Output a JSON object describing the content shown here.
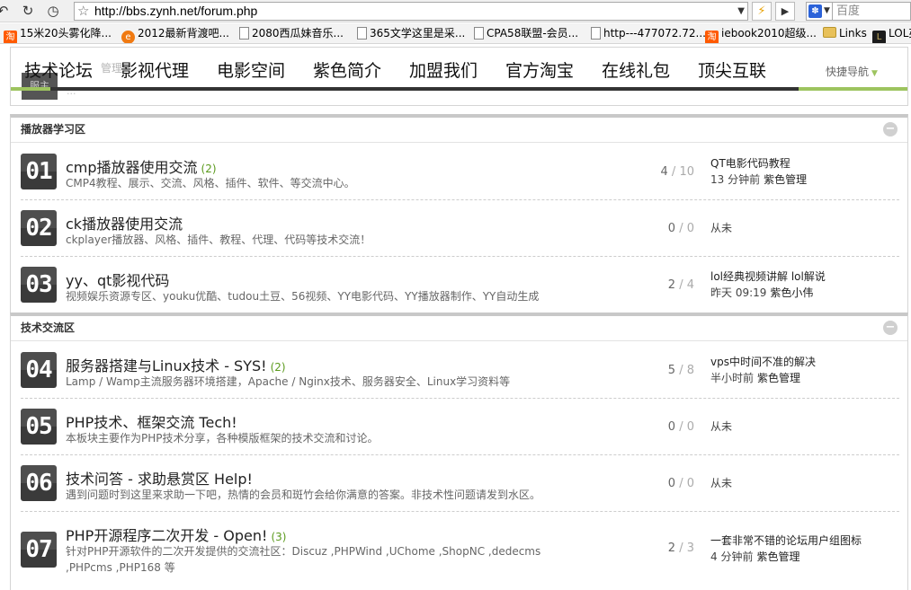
{
  "browser": {
    "url": "http://bbs.zynh.net/forum.php",
    "search_placeholder": "百度",
    "bookmarks": [
      {
        "label": "15米20头雾化降...",
        "icon": "taobao-icon"
      },
      {
        "label": "2012最新背渡吧...",
        "icon": "circle-icon"
      },
      {
        "label": "2080西瓜妹音乐...",
        "icon": "page-icon"
      },
      {
        "label": "365文学这里是采...",
        "icon": "page-icon"
      },
      {
        "label": "CPA58联盟-会员...",
        "icon": "page-icon"
      },
      {
        "label": "http---477072.72...",
        "icon": "page-icon"
      },
      {
        "label": "iebook2010超级...",
        "icon": "taobao-icon"
      },
      {
        "label": "Links",
        "icon": "folder-icon"
      },
      {
        "label": "LOL英",
        "icon": "lol-icon"
      }
    ]
  },
  "header": {
    "under_text": "管理",
    "under_text2": "...",
    "logo_text": "服主",
    "nav": [
      "技术论坛",
      "影视代理",
      "电影空间",
      "紫色简介",
      "加盟我们",
      "官方淘宝",
      "在线礼包",
      "顶尖互联"
    ],
    "quick_nav": "快捷导航"
  },
  "sections": [
    {
      "title": "播放器学习区",
      "forums": [
        {
          "num": "01",
          "title": "cmp播放器使用交流",
          "today": "(2)",
          "desc": "CMP4教程、展示、交流、风格、插件、软件、等交流中心。",
          "threads": "4",
          "posts": "10",
          "last_subject": "QT电影代码教程",
          "last_time": "13 分钟前",
          "last_user": "紫色管理",
          "never": ""
        },
        {
          "num": "02",
          "title": "ck播放器使用交流",
          "today": "",
          "desc": "ckplayer播放器、风格、插件、教程、代理、代码等技术交流！",
          "threads": "0",
          "posts": "0",
          "last_subject": "",
          "last_time": "",
          "last_user": "",
          "never": "从未"
        },
        {
          "num": "03",
          "title": "yy、qt影视代码",
          "today": "",
          "desc": "视频娱乐资源专区、youku优酷、tudou土豆、56视频、YY电影代码、YY播放器制作、YY自动生成",
          "threads": "2",
          "posts": "4",
          "last_subject": "lol经典视频讲解 lol解说",
          "last_time": "昨天 09:19",
          "last_user": "紫色小伟",
          "never": ""
        }
      ]
    },
    {
      "title": "技术交流区",
      "forums": [
        {
          "num": "04",
          "title": "服务器搭建与Linux技术 - SYS!",
          "today": "(2)",
          "desc": "Lamp / Wamp主流服务器环境搭建，Apache / Nginx技术、服务器安全、Linux学习资料等",
          "threads": "5",
          "posts": "8",
          "last_subject": "vps中时间不准的解决",
          "last_time": "半小时前",
          "last_user": "紫色管理",
          "never": ""
        },
        {
          "num": "05",
          "title": "PHP技术、框架交流 Tech!",
          "today": "",
          "desc": "本板块主要作为PHP技术分享，各种模版框架的技术交流和讨论。",
          "threads": "0",
          "posts": "0",
          "last_subject": "",
          "last_time": "",
          "last_user": "",
          "never": "从未"
        },
        {
          "num": "06",
          "title": "技术问答 - 求助悬赏区 Help!",
          "today": "",
          "desc": "遇到问题时到这里来求助一下吧，热情的会员和斑竹会给你满意的答案。非技术性问题请发到水区。",
          "threads": "0",
          "posts": "0",
          "last_subject": "",
          "last_time": "",
          "last_user": "",
          "never": "从未"
        },
        {
          "num": "07",
          "title": "PHP开源程序二次开发 - Open!",
          "today": "(3)",
          "desc": "针对PHP开源软件的二次开发提供的交流社区：Discuz ,PHPWind ,UChome ,ShopNC ,dedecms ,PHPcms ,PHP168 等",
          "threads": "2",
          "posts": "3",
          "last_subject": "一套非常不错的论坛用户组图标",
          "last_time": "4 分钟前",
          "last_user": "紫色管理",
          "never": ""
        }
      ]
    }
  ],
  "icons": {
    "back": "back-icon",
    "reload": "reload-icon",
    "history": "history-icon",
    "bookmark_star": "star-icon",
    "collapse": "collapse-icon"
  },
  "colors": {
    "accent_green": "#9dc45f",
    "nav_bar": "#333333",
    "number_block": "#3a3a3a"
  }
}
